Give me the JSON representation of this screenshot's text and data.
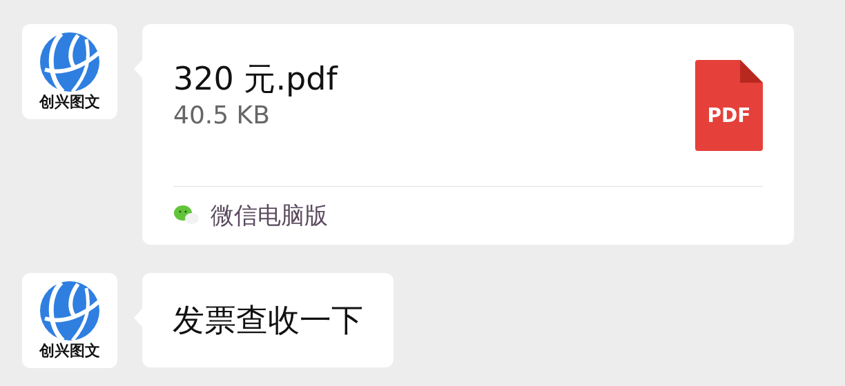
{
  "messages": [
    {
      "kind": "file",
      "avatar_label": "创兴图文",
      "file_name": "320 元.pdf",
      "file_size": "40.5 KB",
      "file_badge": "PDF",
      "source": "微信电脑版"
    },
    {
      "kind": "text",
      "avatar_label": "创兴图文",
      "text": "发票查收一下"
    }
  ]
}
